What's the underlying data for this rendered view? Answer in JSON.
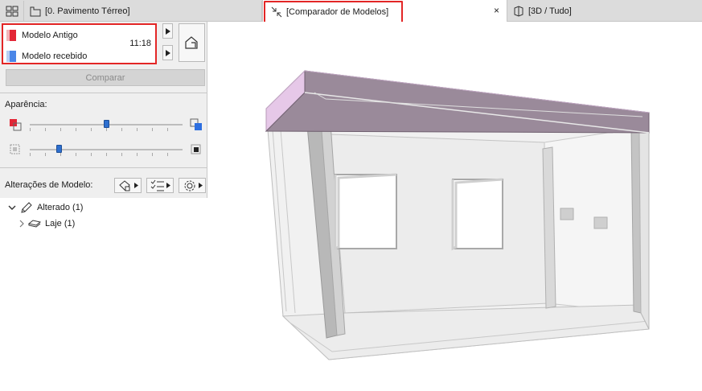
{
  "tabs": {
    "plan_label": "[0. Pavimento Térreo]",
    "compare_label": "[Comparador de Modelos]",
    "close_glyph": "×",
    "view3d_label": "[3D / Tudo]"
  },
  "models": {
    "old": {
      "label": "Modelo Antigo",
      "color": "#e32636"
    },
    "received": {
      "label": "Modelo recebido",
      "color": "#4a86e8"
    },
    "time": "11:18"
  },
  "compare_button": "Comparar",
  "appearance": {
    "title": "Aparência:",
    "slider1_value": 0.5,
    "slider2_value": 0.18
  },
  "changes": {
    "title": "Alterações de Modelo:",
    "tree": [
      {
        "label": "Alterado (1)",
        "expanded": true,
        "level": 0
      },
      {
        "label": "Laje (1)",
        "expanded": false,
        "level": 1
      }
    ]
  },
  "colors": {
    "highlight": "#e32626",
    "slab_top": "#9a8a9a",
    "slab_side": "#e6c8e8"
  }
}
